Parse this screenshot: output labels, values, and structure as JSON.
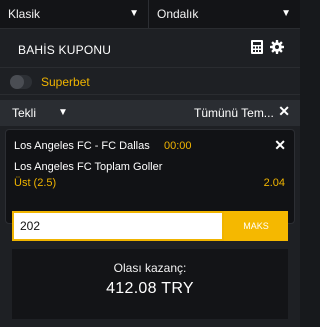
{
  "top_selects": {
    "format": "Klasik",
    "odds_format": "Ondalık"
  },
  "coupon": {
    "title": "BAHİS KUPONU",
    "icons": [
      "calculator-icon",
      "gear-icon"
    ]
  },
  "superbet": {
    "label": "Superbet",
    "enabled": false
  },
  "bet_type": {
    "selected": "Tekli",
    "clear_all": "Tümünü Tem..."
  },
  "bet": {
    "match": "Los Angeles FC - FC Dallas",
    "time": "00:00",
    "market": "Los Angeles FC Toplam Goller",
    "selection": "Üst (2.5)",
    "odds": "2.04"
  },
  "stake": {
    "value": "202",
    "max_label": "MAKS"
  },
  "winnings": {
    "label": "Olası kazanç:",
    "value": "412.08 TRY"
  },
  "colors": {
    "accent": "#f0b400",
    "background": "#1e2024",
    "panel": "#131417"
  }
}
